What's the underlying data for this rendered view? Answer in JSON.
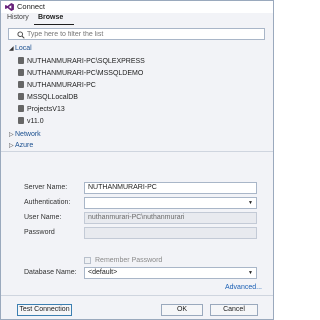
{
  "window": {
    "title": "Connect"
  },
  "tabs": [
    {
      "label": "History"
    },
    {
      "label": "Browse"
    }
  ],
  "search": {
    "placeholder": "Type here to filter the list"
  },
  "tree": {
    "local": {
      "label": "Local",
      "items": [
        {
          "label": "NUTHANMURARI-PC\\SQLEXPRESS"
        },
        {
          "label": "NUTHANMURARI-PC\\MSSQLDEMO"
        },
        {
          "label": "NUTHANMURARI-PC"
        },
        {
          "label": "MSSQLLocalDB"
        },
        {
          "label": "ProjectsV13"
        },
        {
          "label": "v11.0"
        }
      ]
    },
    "network": {
      "label": "Network"
    },
    "azure": {
      "label": "Azure"
    }
  },
  "form": {
    "server_name": {
      "label": "Server Name:",
      "value": "NUTHANMURARI-PC"
    },
    "authentication": {
      "label": "Authentication:",
      "value": ""
    },
    "user_name": {
      "label": "User Name:",
      "value": "nuthanmurari-PC\\nuthanmurari"
    },
    "password": {
      "label": "Password",
      "value": ""
    },
    "remember_password": {
      "label": "Remember Password"
    },
    "database_name": {
      "label": "Database Name:",
      "value": "<default>"
    },
    "advanced_label": "Advanced..."
  },
  "buttons": {
    "test_connection": "Test Connection",
    "ok": "OK",
    "cancel": "Cancel"
  },
  "colors": {
    "accent": "#68217a",
    "link": "#1a5fb4",
    "window_bg": "#f2f3f7"
  }
}
